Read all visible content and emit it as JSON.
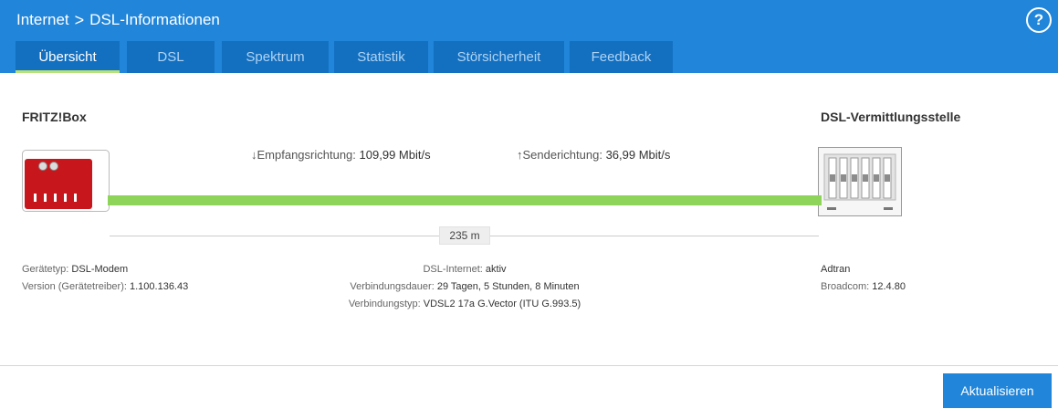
{
  "header": {
    "breadcrumb": {
      "section": "Internet",
      "separator": ">",
      "page": "DSL-Informationen"
    },
    "help_label": "?"
  },
  "tabs": [
    {
      "label": "Übersicht",
      "active": true
    },
    {
      "label": "DSL",
      "active": false
    },
    {
      "label": "Spektrum",
      "active": false
    },
    {
      "label": "Statistik",
      "active": false
    },
    {
      "label": "Störsicherheit",
      "active": false
    },
    {
      "label": "Feedback",
      "active": false
    }
  ],
  "diagram": {
    "left_device": "FRITZ!Box",
    "right_device": "DSL-Vermittlungsstelle",
    "downstream": {
      "arrow": "↓",
      "label": "Empfangsrichtung:",
      "value": "109,99 Mbit/s"
    },
    "upstream": {
      "arrow": "↑",
      "label": "Senderichtung:",
      "value": "36,99 Mbit/s"
    },
    "distance": "235 m",
    "line_color": "#8fd45a"
  },
  "left_info": {
    "device_type_label": "Gerätetyp:",
    "device_type_value": "DSL-Modem",
    "version_label": "Version (Gerätetreiber):",
    "version_value": "1.100.136.43"
  },
  "center_info": {
    "dsl_internet_label": "DSL-Internet:",
    "dsl_internet_value": "aktiv",
    "duration_label": "Verbindungsdauer:",
    "duration_value": "29 Tagen, 5 Stunden, 8 Minuten",
    "type_label": "Verbindungstyp:",
    "type_value": "VDSL2 17a G.Vector (ITU G.993.5)"
  },
  "right_info": {
    "vendor": "Adtran",
    "chipset_label": "Broadcom:",
    "chipset_value": "12.4.80"
  },
  "footer": {
    "refresh_label": "Aktualisieren"
  },
  "colors": {
    "header": "#2185d9",
    "tab": "#1370c1",
    "active_underline": "#b7e27a",
    "router_red": "#c8161d"
  }
}
